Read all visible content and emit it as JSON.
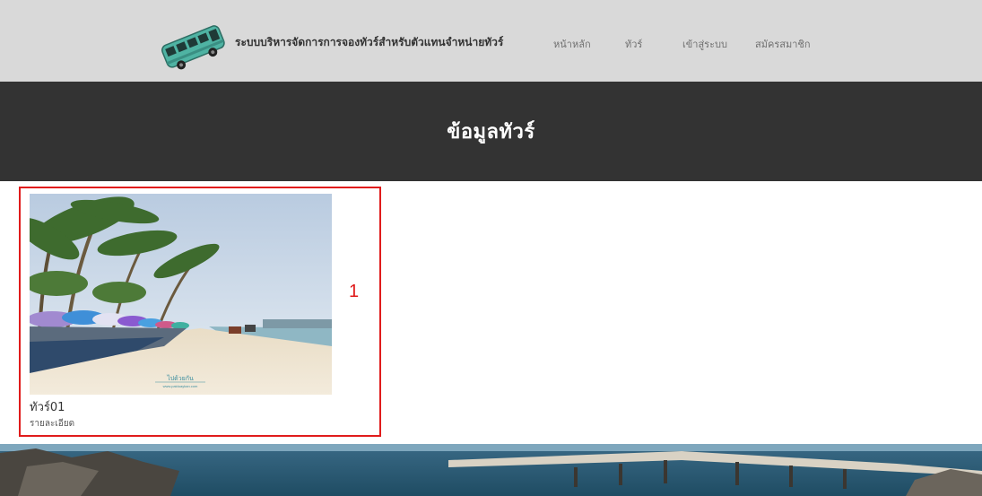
{
  "header": {
    "brand_title": "ระบบบริหารจัดการการจองทัวร์สำหรับตัวแทนจำหน่ายทัวร์",
    "logo_icon": "bus-icon",
    "nav": [
      {
        "label": "หน้าหลัก"
      },
      {
        "label": "ทัวร์"
      },
      {
        "label": "เข้าสู่ระบบ"
      },
      {
        "label": "สมัครสมาชิก"
      }
    ]
  },
  "hero": {
    "title": "ข้อมูลทัวร์"
  },
  "tours": [
    {
      "name": "ทัวร์01",
      "detail_link": "รายละเอียด",
      "image_watermark": "ไปด้วยกัน",
      "image_watermark_sub": "www.paiduaykan.com"
    }
  ],
  "annotation": {
    "label": "1"
  },
  "colors": {
    "topbar": "#d9d9d9",
    "hero": "#333333",
    "highlight": "#e01b1b",
    "bus_body": "#4fb3a3"
  }
}
